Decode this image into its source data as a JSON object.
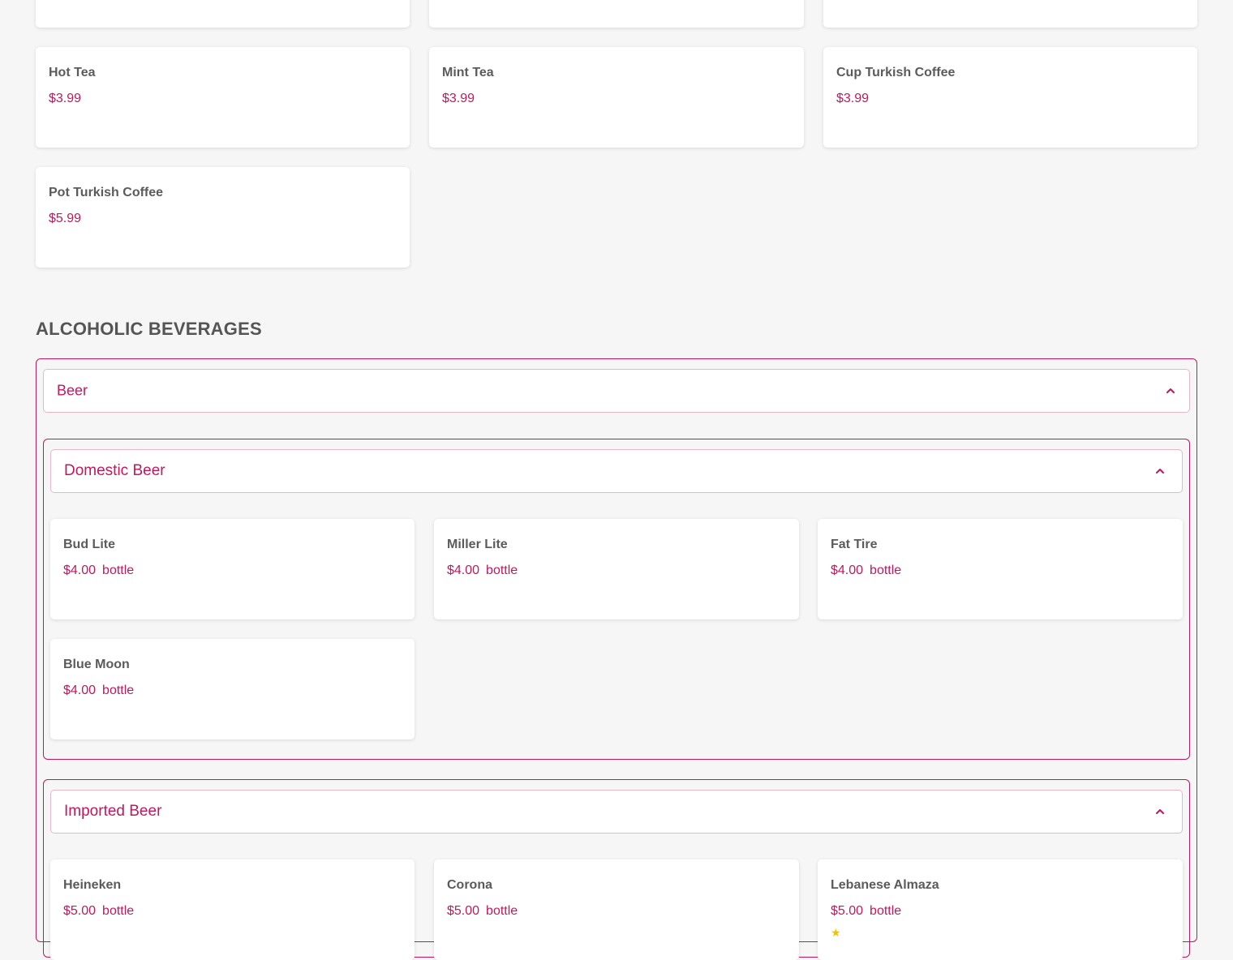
{
  "hot_drinks": [
    {
      "name": "Hot Tea",
      "price": "$3.99"
    },
    {
      "name": "Mint Tea",
      "price": "$3.99"
    },
    {
      "name": "Cup Turkish Coffee",
      "price": "$3.99"
    },
    {
      "name": "Pot Turkish Coffee",
      "price": "$5.99"
    }
  ],
  "section": {
    "title": "ALCOHOLIC BEVERAGES"
  },
  "beer": {
    "label": "Beer",
    "domestic": {
      "label": "Domestic Beer",
      "items": [
        {
          "name": "Bud Lite",
          "price": "$4.00",
          "unit": "bottle"
        },
        {
          "name": "Miller Lite",
          "price": "$4.00",
          "unit": "bottle"
        },
        {
          "name": "Fat Tire",
          "price": "$4.00",
          "unit": "bottle"
        },
        {
          "name": "Blue Moon",
          "price": "$4.00",
          "unit": "bottle"
        }
      ]
    },
    "imported": {
      "label": "Imported Beer",
      "items": [
        {
          "name": "Heineken",
          "price": "$5.00",
          "unit": "bottle"
        },
        {
          "name": "Corona",
          "price": "$5.00",
          "unit": "bottle"
        },
        {
          "name": "Lebanese Almaza",
          "price": "$5.00",
          "unit": "bottle"
        }
      ]
    }
  },
  "colors": {
    "accent": "#c2185b",
    "background": "#f6f6f6",
    "card": "#ffffff"
  },
  "icons": {
    "collapse": "chevron-up-icon"
  }
}
